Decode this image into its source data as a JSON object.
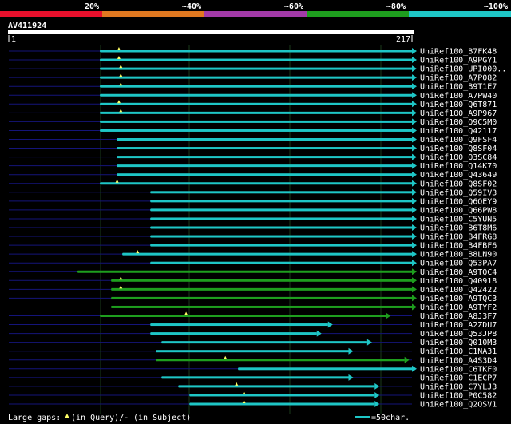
{
  "query": {
    "name": "AV411924",
    "start_label": "1",
    "end_label": "217",
    "length": 217
  },
  "identity_scale": {
    "labels": [
      "20%",
      "~40%",
      "~60%",
      "~80%",
      "~100%"
    ],
    "colors": [
      "#e8102c",
      "#e07820",
      "#a23aa8",
      "#1e9e1e",
      "#1ec6c6"
    ]
  },
  "colors": {
    "background": "#000000",
    "hit_high": "#1ec6c6",
    "hit_mid": "#1e9e1e",
    "unaligned_line": "#14147a",
    "marker": "#ffff66"
  },
  "hits": [
    {
      "name": "UniRef100_B7FK48",
      "start": 50,
      "end": 217,
      "color": "cyan",
      "gap": 60
    },
    {
      "name": "UniRef100_A9PGY1",
      "start": 50,
      "end": 217,
      "color": "cyan",
      "gap": 60
    },
    {
      "name": "UniRef100_UPI000..",
      "start": 50,
      "end": 217,
      "color": "cyan",
      "gap": 61
    },
    {
      "name": "UniRef100_A7P082",
      "start": 50,
      "end": 217,
      "color": "cyan",
      "gap": 61
    },
    {
      "name": "UniRef100_B9T1E7",
      "start": 50,
      "end": 217,
      "color": "cyan",
      "gap": 61
    },
    {
      "name": "UniRef100_A7PW40",
      "start": 50,
      "end": 217,
      "color": "cyan",
      "gap": null
    },
    {
      "name": "UniRef100_Q6T871",
      "start": 50,
      "end": 217,
      "color": "cyan",
      "gap": 60
    },
    {
      "name": "UniRef100_A9P967",
      "start": 50,
      "end": 217,
      "color": "cyan",
      "gap": 61
    },
    {
      "name": "UniRef100_Q9C5M0",
      "start": 50,
      "end": 217,
      "color": "cyan",
      "gap": null
    },
    {
      "name": "UniRef100_Q42117",
      "start": 50,
      "end": 217,
      "color": "cyan",
      "gap": null
    },
    {
      "name": "UniRef100_Q9FSF4",
      "start": 59,
      "end": 217,
      "color": "cyan",
      "gap": null
    },
    {
      "name": "UniRef100_Q8SF04",
      "start": 59,
      "end": 217,
      "color": "cyan",
      "gap": null
    },
    {
      "name": "UniRef100_Q3SC84",
      "start": 59,
      "end": 217,
      "color": "cyan",
      "gap": null
    },
    {
      "name": "UniRef100_Q14K70",
      "start": 59,
      "end": 217,
      "color": "cyan",
      "gap": null
    },
    {
      "name": "UniRef100_Q43649",
      "start": 59,
      "end": 217,
      "color": "cyan",
      "gap": null
    },
    {
      "name": "UniRef100_Q8SF02",
      "start": 50,
      "end": 217,
      "color": "cyan",
      "gap": 59
    },
    {
      "name": "UniRef100_Q59IV3",
      "start": 77,
      "end": 217,
      "color": "cyan",
      "gap": null
    },
    {
      "name": "UniRef100_Q6QEY9",
      "start": 77,
      "end": 217,
      "color": "cyan",
      "gap": null
    },
    {
      "name": "UniRef100_Q66PW8",
      "start": 77,
      "end": 217,
      "color": "cyan",
      "gap": null
    },
    {
      "name": "UniRef100_C5YUN5",
      "start": 77,
      "end": 217,
      "color": "cyan",
      "gap": null
    },
    {
      "name": "UniRef100_B6T8M6",
      "start": 77,
      "end": 217,
      "color": "cyan",
      "gap": null
    },
    {
      "name": "UniRef100_B4FRG8",
      "start": 77,
      "end": 217,
      "color": "cyan",
      "gap": null
    },
    {
      "name": "UniRef100_B4FBF6",
      "start": 77,
      "end": 217,
      "color": "cyan",
      "gap": null
    },
    {
      "name": "UniRef100_B8LN90",
      "start": 62,
      "end": 217,
      "color": "cyan",
      "gap": 70
    },
    {
      "name": "UniRef100_Q53PA7",
      "start": 77,
      "end": 217,
      "color": "cyan",
      "gap": null
    },
    {
      "name": "UniRef100_A9TQC4",
      "start": 38,
      "end": 217,
      "color": "green",
      "gap": null
    },
    {
      "name": "UniRef100_Q40918",
      "start": 56,
      "end": 217,
      "color": "green",
      "gap": 61
    },
    {
      "name": "UniRef100_Q42422",
      "start": 56,
      "end": 217,
      "color": "green",
      "gap": 61
    },
    {
      "name": "UniRef100_A9TQC3",
      "start": 56,
      "end": 217,
      "color": "green",
      "gap": null
    },
    {
      "name": "UniRef100_A9TYF2",
      "start": 56,
      "end": 217,
      "color": "green",
      "gap": null
    },
    {
      "name": "UniRef100_A8J3F7",
      "start": 50,
      "end": 203,
      "color": "green",
      "gap": 96
    },
    {
      "name": "UniRef100_A2ZDU7",
      "start": 77,
      "end": 172,
      "color": "cyan",
      "gap": null
    },
    {
      "name": "UniRef100_Q53JP8",
      "start": 77,
      "end": 166,
      "color": "cyan",
      "gap": null
    },
    {
      "name": "UniRef100_Q010M3",
      "start": 83,
      "end": 193,
      "color": "cyan",
      "gap": null
    },
    {
      "name": "UniRef100_C1NA31",
      "start": 80,
      "end": 183,
      "color": "cyan",
      "gap": null
    },
    {
      "name": "UniRef100_A4S3D4",
      "start": 80,
      "end": 213,
      "color": "green",
      "gap": 117
    },
    {
      "name": "UniRef100_C6TKF0",
      "start": 124,
      "end": 217,
      "color": "cyan",
      "gap": null
    },
    {
      "name": "UniRef100_C1ECP7",
      "start": 83,
      "end": 183,
      "color": "cyan",
      "gap": null
    },
    {
      "name": "UniRef100_C7YLJ3",
      "start": 92,
      "end": 197,
      "color": "cyan",
      "gap": 123
    },
    {
      "name": "UniRef100_P0C582",
      "start": 98,
      "end": 197,
      "color": "cyan",
      "gap": 127
    },
    {
      "name": "UniRef100_Q2QSV1",
      "start": 98,
      "end": 197,
      "color": "cyan",
      "gap": 127
    }
  ],
  "legend": {
    "gaps_text": "Large gaps:",
    "gaps_query": "(in Query)/-",
    "gaps_subject": "(in Subject)",
    "scale_text": "=50char."
  }
}
